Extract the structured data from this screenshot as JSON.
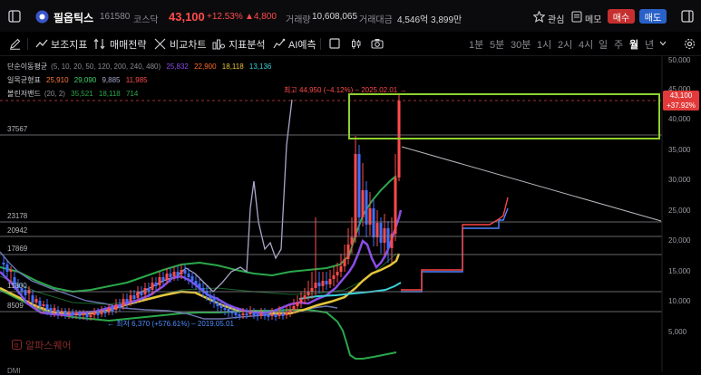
{
  "header": {
    "stock_name": "필옵틱스",
    "code": "161580",
    "market": "코스닥",
    "price": "43,100",
    "change_pct": "+12.53%",
    "change_amt": "▲4,800",
    "volume_label": "거래량",
    "volume": "10,608,065",
    "amount_label": "거래대금",
    "amount": "4,546억 3,899만",
    "watch_label": "관심",
    "memo_label": "메모",
    "buy_label": "매수",
    "sell_label": "매도"
  },
  "toolbar": {
    "indicator": "보조지표",
    "strategy": "매매전략",
    "compare": "비교차트",
    "analysis": "지표분석",
    "ai": "AI예측",
    "periods": [
      "1분",
      "5분",
      "30분",
      "1시",
      "2시",
      "4시",
      "일",
      "주",
      "월",
      "년"
    ],
    "active_period": "월"
  },
  "legend": {
    "ma_label": "단순이동평균",
    "ma_params": "(5, 10, 20, 50, 120, 200, 240, 480)",
    "ma_values": [
      "25,832",
      "22,900",
      "18,118",
      "13,136"
    ],
    "ichimoku_label": "일목균형표",
    "ichimoku_values": [
      "25,910",
      "29,090",
      "9,885",
      "11,985"
    ],
    "bb_label": "볼린저밴드",
    "bb_params": "(20, 2)",
    "bb_values": [
      "35,521",
      "18,118",
      "714"
    ]
  },
  "annotations": {
    "high": "최고 44,950 (−4.12%) – 2025.02.01 →",
    "low": "← 최저 6,370 (+576.61%) – 2019.05.01",
    "watermark": "알파스퀘어",
    "price_tag_value": "43,100",
    "price_tag_pct": "+37.92%",
    "bottom_label": "DMI"
  },
  "levels": [
    "37567",
    "23178",
    "20942",
    "17869",
    "11800",
    "8509"
  ],
  "y_axis": [
    "50,000",
    "45,000",
    "40,000",
    "35,000",
    "30,000",
    "25,000",
    "20,000",
    "15,000",
    "10,000",
    "5,000"
  ],
  "colors": {
    "up": "#ff4b4b",
    "down": "#3f6fff",
    "highlight_box": "#8ed12e",
    "accent_blue": "#2a61c9",
    "accent_red": "#c62f2f"
  }
}
